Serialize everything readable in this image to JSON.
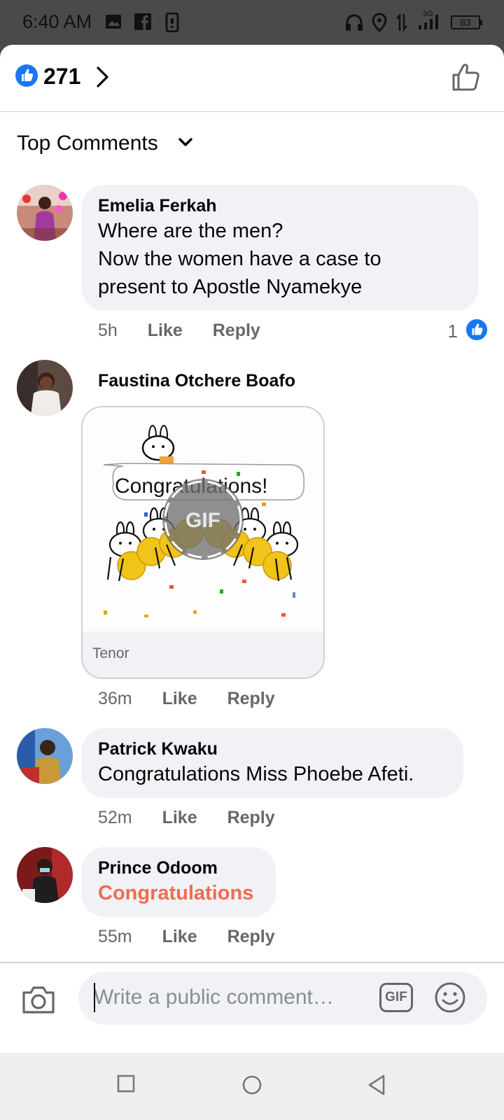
{
  "status_bar": {
    "time": "6:40 AM",
    "network": "3G",
    "battery": "83"
  },
  "header": {
    "reaction_count": "271"
  },
  "sort": {
    "label": "Top Comments"
  },
  "comments": [
    {
      "author": "Emelia Ferkah",
      "lines": [
        "Where are the men?",
        "Now the women have a case to",
        "present to Apostle Nyamekye"
      ],
      "time": "5h",
      "like": "Like",
      "reply": "Reply",
      "like_count": "1"
    },
    {
      "author": "Faustina Otchere Boafo",
      "gif": {
        "caption": "Congratulations!",
        "badge": "GIF",
        "source": "Tenor"
      },
      "time": "36m",
      "like": "Like",
      "reply": "Reply"
    },
    {
      "author": "Patrick Kwaku",
      "text": "Congratulations Miss Phoebe Afeti.",
      "time": "52m",
      "like": "Like",
      "reply": "Reply"
    },
    {
      "author": "Prince Odoom",
      "text": "Congratulations",
      "time": "55m",
      "like": "Like",
      "reply": "Reply"
    }
  ],
  "composer": {
    "placeholder": "Write a public comment…",
    "gif_label": "GIF"
  },
  "colors": {
    "facebook_blue": "#1877f2",
    "highlight_text": "#f26b50",
    "bubble_bg": "#f0f2f5",
    "meta_text": "#65676b"
  }
}
